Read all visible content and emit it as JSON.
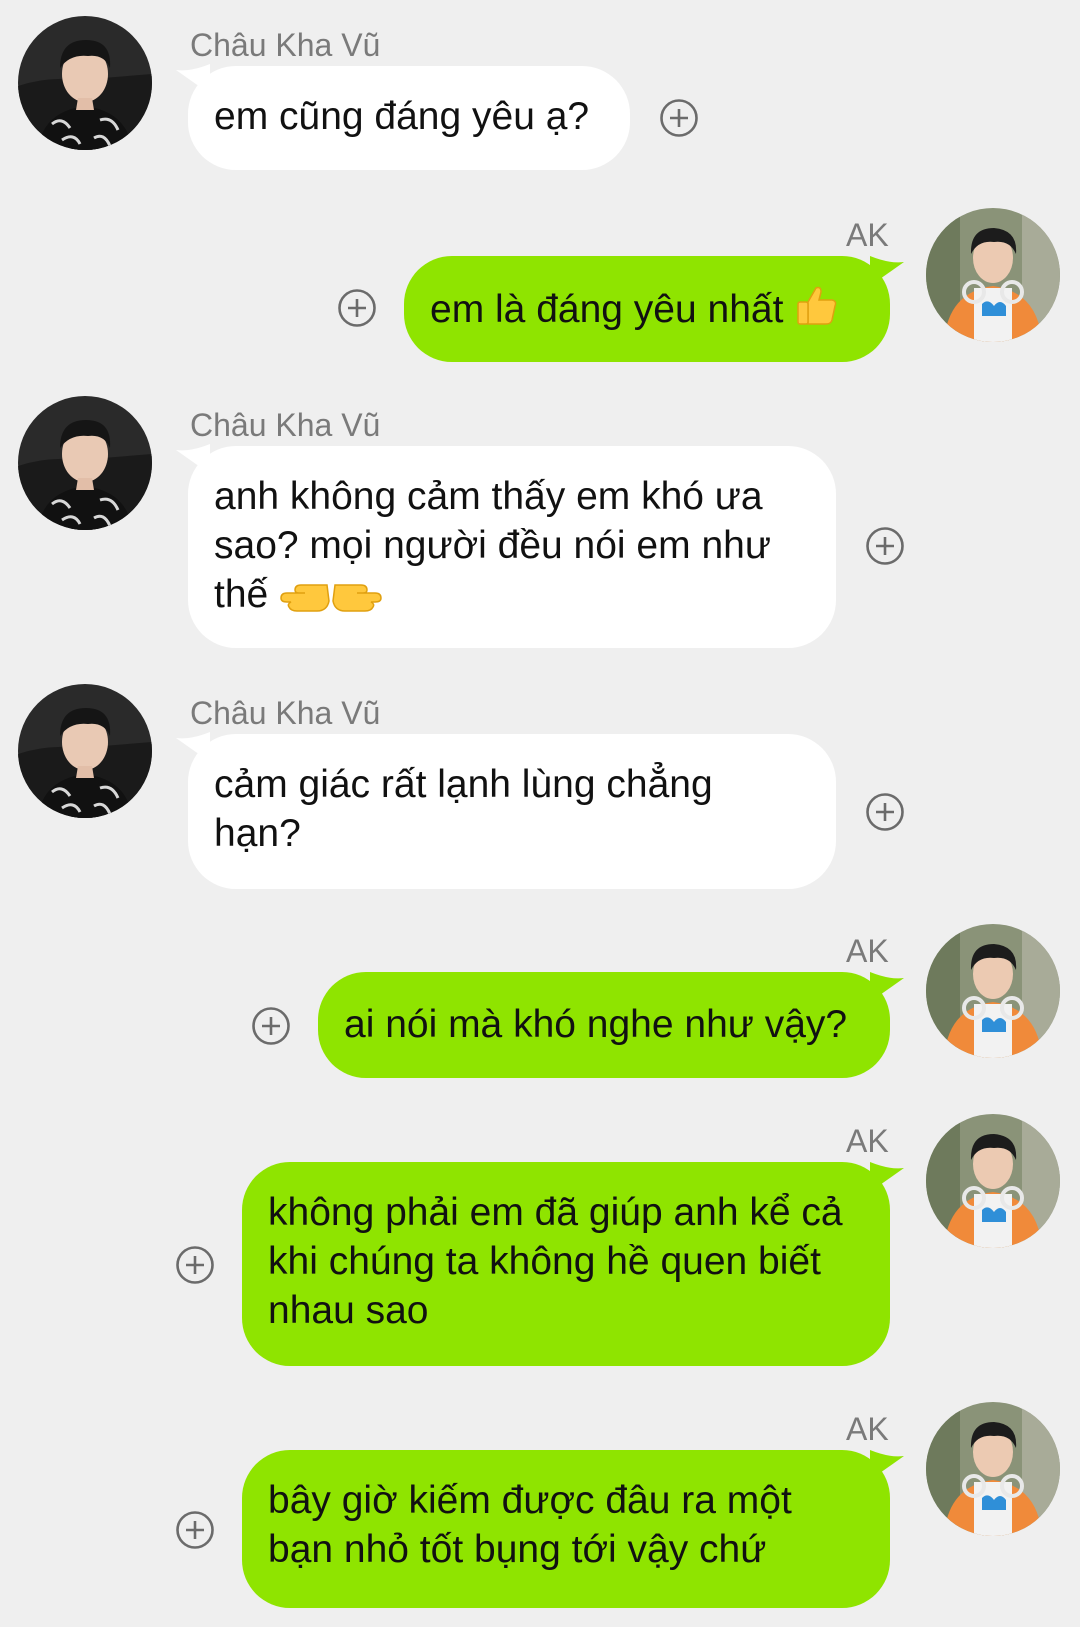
{
  "contacts": {
    "other": {
      "name": "Châu Kha Vũ"
    },
    "me": {
      "name": "AK"
    }
  },
  "messages": [
    {
      "sender": "other",
      "name": "Châu Kha Vũ",
      "text": "em cũng đáng yêu ạ?",
      "emoji": ""
    },
    {
      "sender": "me",
      "name": "AK",
      "text": "em là đáng yêu nhất",
      "emoji": "thumbs-up"
    },
    {
      "sender": "other",
      "name": "Châu Kha Vũ",
      "text": "anh không cảm thấy em khó ưa sao? mọi người đều nói em như thế",
      "emoji": "pointing-hands"
    },
    {
      "sender": "other",
      "name": "Châu Kha Vũ",
      "text": "cảm giác rất lạnh lùng chẳng hạn?",
      "emoji": ""
    },
    {
      "sender": "me",
      "name": "AK",
      "text": "ai nói mà khó nghe như vậy?",
      "emoji": ""
    },
    {
      "sender": "me",
      "name": "AK",
      "text": "không phải em đã giúp anh kể cả khi chúng ta không hề quen biết nhau sao",
      "emoji": ""
    },
    {
      "sender": "me",
      "name": "AK",
      "text": "bây giờ kiếm được đâu ra một bạn nhỏ tốt bụng tới vậy chứ",
      "emoji": ""
    }
  ],
  "colors": {
    "background": "#efefef",
    "incoming_bubble": "#ffffff",
    "outgoing_bubble": "#8fe400",
    "name_text": "#7a7a7a"
  }
}
